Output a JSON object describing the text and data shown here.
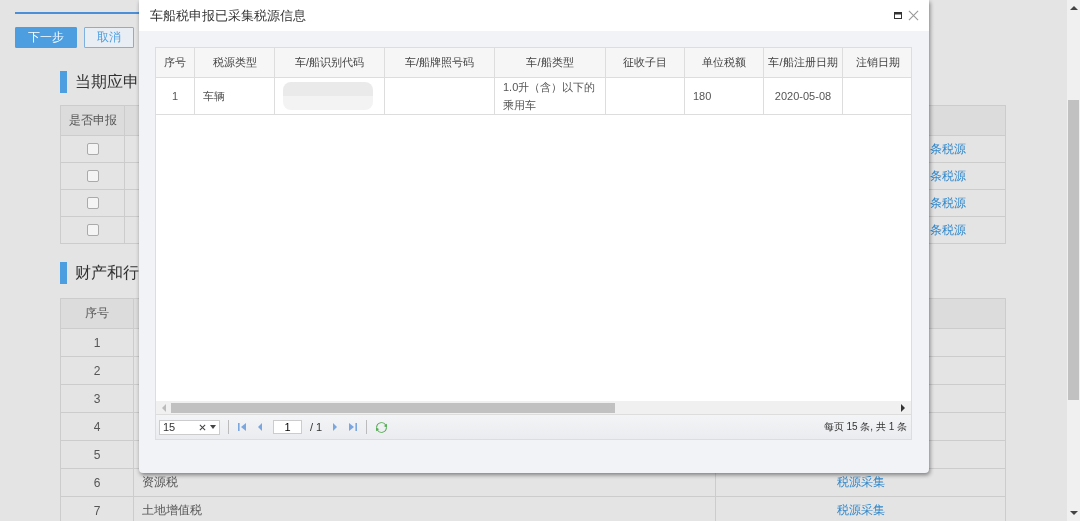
{
  "page": {
    "buttons": [
      {
        "label": "下一步",
        "kind": "primary"
      },
      {
        "label": "取消",
        "kind": "secondary"
      }
    ],
    "section_1": {
      "title": "当期应申",
      "table": {
        "columns": [
          "是否申报"
        ],
        "rows": [
          {
            "checked": false,
            "link": "条税源"
          },
          {
            "checked": false,
            "link": "条税源"
          },
          {
            "checked": false,
            "link": "条税源"
          },
          {
            "checked": false,
            "link": "条税源"
          }
        ]
      }
    },
    "section_2": {
      "title": "财产和行",
      "table": {
        "columns": [
          "序号"
        ],
        "rows": [
          {
            "no": "1"
          },
          {
            "no": "2"
          },
          {
            "no": "3"
          },
          {
            "no": "4"
          },
          {
            "no": "5"
          },
          {
            "no": "6",
            "name": "资源税",
            "link": "税源采集"
          },
          {
            "no": "7",
            "name": "土地增值税",
            "link": "税源采集"
          }
        ]
      }
    }
  },
  "dialog": {
    "title": "车船税申报已采集税源信息",
    "table": {
      "columns": [
        "序号",
        "税源类型",
        "车/船识别代码",
        "车/船牌照号码",
        "车/船类型",
        "征收子目",
        "单位税额",
        "车/船注册日期",
        "注销日期"
      ],
      "rows": [
        {
          "cells": [
            {
              "kind": "text",
              "text": "1"
            },
            {
              "kind": "text",
              "text": "车辆"
            },
            {
              "kind": "blurred"
            },
            {
              "kind": "empty"
            },
            {
              "kind": "text",
              "text": "1.0升（含）以下的乘用车"
            },
            {
              "kind": "empty"
            },
            {
              "kind": "text",
              "text": "180"
            },
            {
              "kind": "text",
              "text": "2020-05-08"
            },
            {
              "kind": "empty"
            }
          ]
        }
      ]
    },
    "pager": {
      "page_size": "15",
      "page": "1",
      "total_pages": "/ 1",
      "summary": "每页 15 条, 共 1 条"
    }
  }
}
